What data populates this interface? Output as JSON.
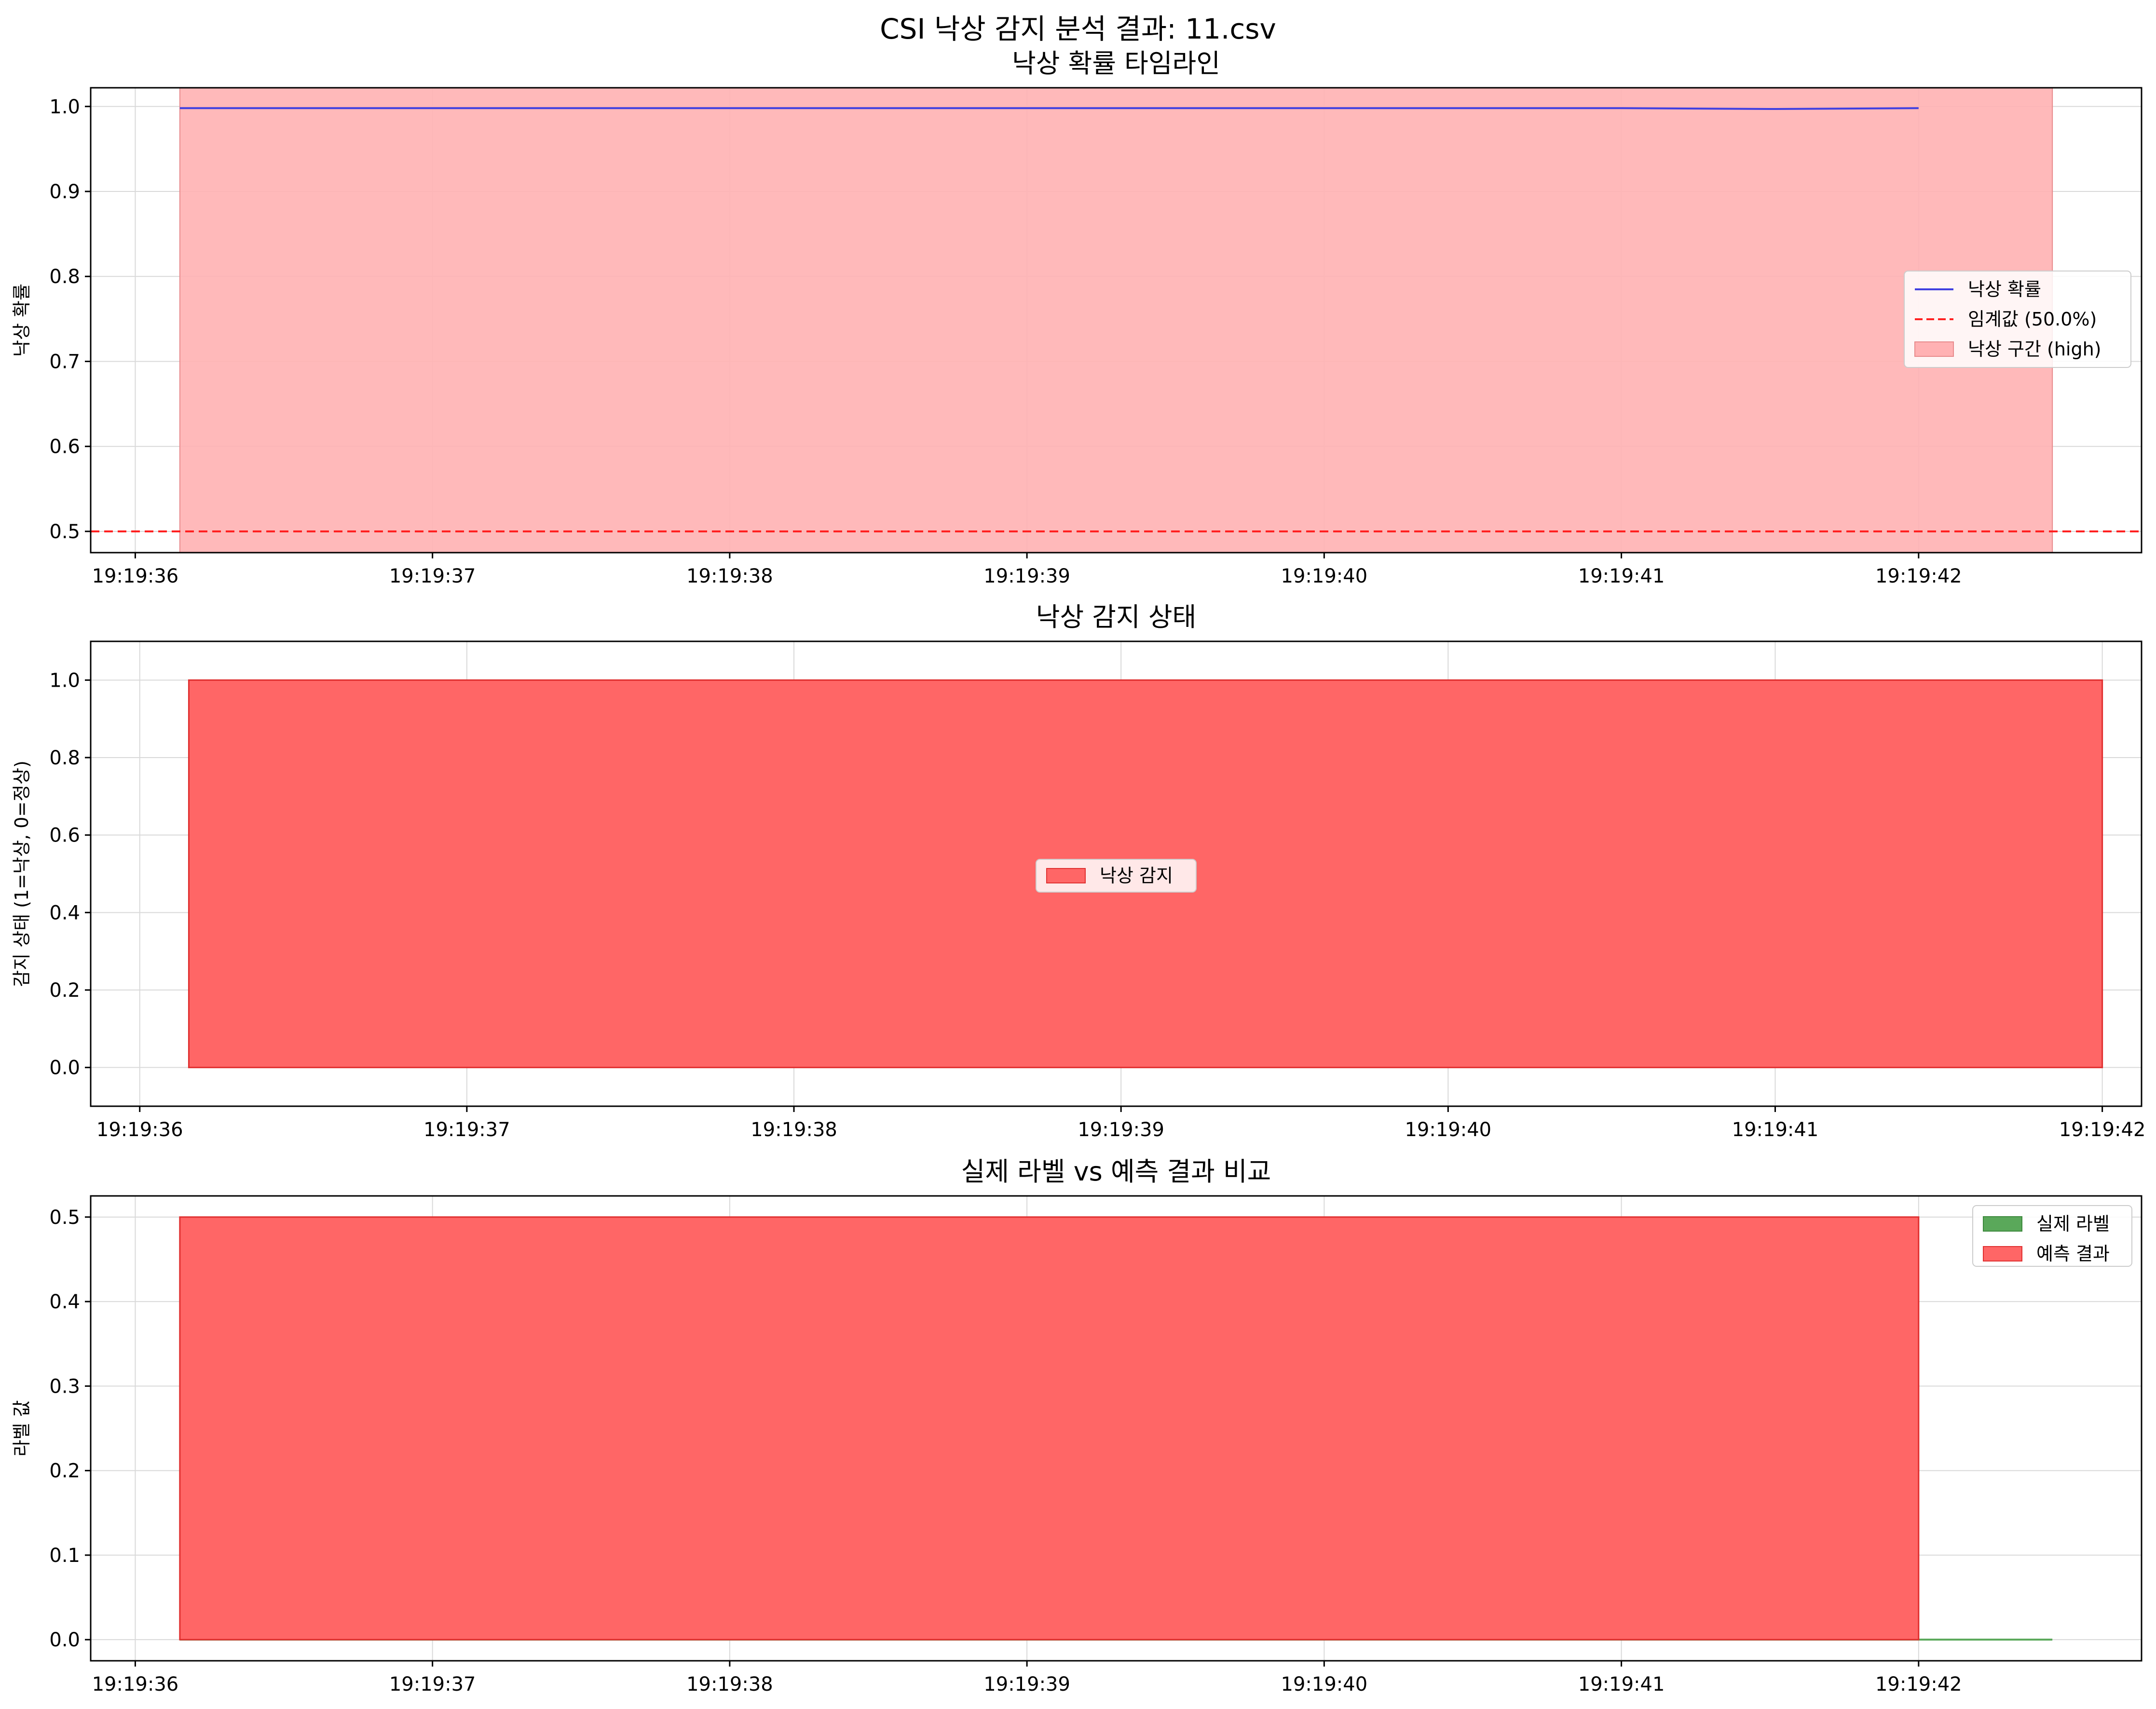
{
  "figure_title": "CSI 낙상 감지 분석 결과: 11.csv",
  "colors": {
    "prob_line": "#4040e0",
    "threshold": "#ff2020",
    "high_zone": "#ffb1b3",
    "detect_fill": "#ff6666",
    "detect_edge": "#e03030",
    "label_green": "#5aa85a",
    "grid": "#d9d9d9"
  },
  "chart_data": [
    {
      "type": "line",
      "title": "낙상 확률 타임라인",
      "xlabel": "",
      "ylabel": "낙상 확률",
      "xticks": [
        "19:19:36",
        "19:19:37",
        "19:19:38",
        "19:19:39",
        "19:19:40",
        "19:19:41",
        "19:19:42"
      ],
      "xlim": [
        "19:19:35.85",
        "19:19:42.75"
      ],
      "ylim": [
        0.475,
        1.022
      ],
      "yticks": [
        "0.5",
        "0.6",
        "0.7",
        "0.8",
        "0.9",
        "1.0"
      ],
      "grid": true,
      "series": [
        {
          "name": "낙상 확률",
          "style": "line",
          "x": [
            "19:19:36.15",
            "19:19:37.0",
            "19:19:38.0",
            "19:19:39.0",
            "19:19:40.0",
            "19:19:41.0",
            "19:19:41.5",
            "19:19:42.0"
          ],
          "values": [
            0.998,
            0.998,
            0.998,
            0.998,
            0.998,
            0.998,
            0.997,
            0.998
          ]
        },
        {
          "name": "임계값 (50.0%)",
          "style": "dashed-hline",
          "value": 0.5
        },
        {
          "name": "낙상 구간 (high)",
          "style": "span",
          "x_start": "19:19:36.15",
          "x_end": "19:19:42.45"
        }
      ],
      "legend": "center-right",
      "legend_entries": [
        {
          "label": "낙상 확률",
          "kind": "line"
        },
        {
          "label": "임계값 (50.0%)",
          "kind": "dashed"
        },
        {
          "label": "낙상 구간 (high)",
          "kind": "patch"
        }
      ]
    },
    {
      "type": "area",
      "title": "낙상 감지 상태",
      "xlabel": "",
      "ylabel": "감지 상태 (1=낙상, 0=정상)",
      "xticks": [
        "19:19:36",
        "19:19:37",
        "19:19:38",
        "19:19:39",
        "19:19:40",
        "19:19:41",
        "19:19:42"
      ],
      "xlim": [
        "19:19:35.85",
        "19:19:42.12"
      ],
      "ylim": [
        -0.1,
        1.1
      ],
      "yticks": [
        "0.0",
        "0.2",
        "0.4",
        "0.6",
        "0.8",
        "1.0"
      ],
      "grid": true,
      "series": [
        {
          "name": "낙상 감지",
          "x_start": "19:19:36.15",
          "x_end": "19:19:42.0",
          "value": 1.0
        }
      ],
      "legend": "center",
      "legend_entries": [
        {
          "label": "낙상 감지",
          "kind": "patch"
        }
      ]
    },
    {
      "type": "area",
      "title": "실제 라벨 vs 예측 결과 비교",
      "xlabel": "",
      "ylabel": "라벨 값",
      "xticks": [
        "19:19:36",
        "19:19:37",
        "19:19:38",
        "19:19:39",
        "19:19:40",
        "19:19:41",
        "19:19:42"
      ],
      "xlim": [
        "19:19:35.85",
        "19:19:42.75"
      ],
      "ylim": [
        -0.025,
        0.525
      ],
      "yticks": [
        "0.0",
        "0.1",
        "0.2",
        "0.3",
        "0.4",
        "0.5"
      ],
      "grid": true,
      "series": [
        {
          "name": "실제 라벨",
          "x_start": "19:19:36.15",
          "x_end": "19:19:42.45",
          "value": 0.0
        },
        {
          "name": "예측 결과",
          "x_start": "19:19:36.15",
          "x_end": "19:19:42.0",
          "value": 0.5
        }
      ],
      "legend": "top-right",
      "legend_entries": [
        {
          "label": "실제 라벨",
          "kind": "patch-green"
        },
        {
          "label": "예측 결과",
          "kind": "patch-red"
        }
      ]
    }
  ]
}
